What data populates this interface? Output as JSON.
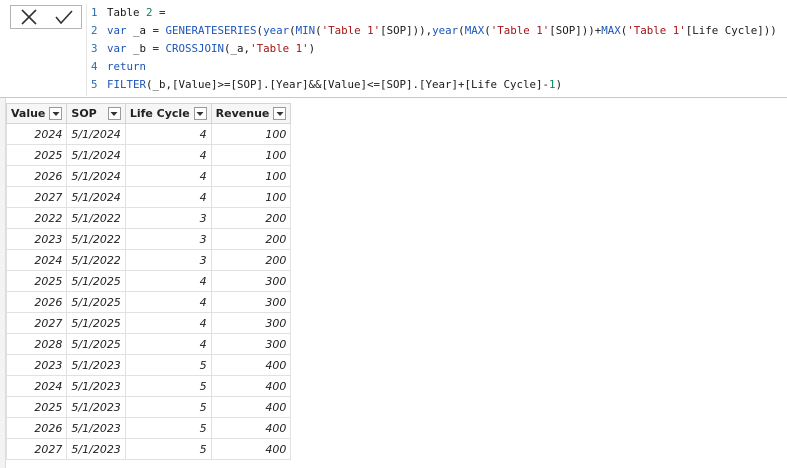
{
  "formula": {
    "lines": [
      {
        "num": "1",
        "text": "Table 2 ="
      },
      {
        "num": "2",
        "text": "var _a = GENERATESERIES(year(MIN('Table 1'[SOP])),year(MAX('Table 1'[SOP]))+MAX('Table 1'[Life Cycle]))"
      },
      {
        "num": "3",
        "text": "var _b = CROSSJOIN(_a,'Table 1')"
      },
      {
        "num": "4",
        "text": "return"
      },
      {
        "num": "5",
        "text": "FILTER(_b,[Value]>=[SOP].[Year]&&[Value]<=[SOP].[Year]+[Life Cycle]-1)"
      }
    ]
  },
  "table": {
    "columns": [
      "Value",
      "SOP",
      "Life Cycle",
      "Revenue"
    ],
    "rows": [
      [
        "2024",
        "5/1/2024",
        "4",
        "100"
      ],
      [
        "2025",
        "5/1/2024",
        "4",
        "100"
      ],
      [
        "2026",
        "5/1/2024",
        "4",
        "100"
      ],
      [
        "2027",
        "5/1/2024",
        "4",
        "100"
      ],
      [
        "2022",
        "5/1/2022",
        "3",
        "200"
      ],
      [
        "2023",
        "5/1/2022",
        "3",
        "200"
      ],
      [
        "2024",
        "5/1/2022",
        "3",
        "200"
      ],
      [
        "2025",
        "5/1/2025",
        "4",
        "300"
      ],
      [
        "2026",
        "5/1/2025",
        "4",
        "300"
      ],
      [
        "2027",
        "5/1/2025",
        "4",
        "300"
      ],
      [
        "2028",
        "5/1/2025",
        "4",
        "300"
      ],
      [
        "2023",
        "5/1/2023",
        "5",
        "400"
      ],
      [
        "2024",
        "5/1/2023",
        "5",
        "400"
      ],
      [
        "2025",
        "5/1/2023",
        "5",
        "400"
      ],
      [
        "2026",
        "5/1/2023",
        "5",
        "400"
      ],
      [
        "2027",
        "5/1/2023",
        "5",
        "400"
      ]
    ]
  },
  "colors": {
    "keyword": "#1c55b8",
    "string": "#a31515",
    "number": "#098658",
    "line_number": "#2b6cb0"
  },
  "icons": {
    "cancel": "close-icon",
    "commit": "checkmark-icon",
    "column_filter": "chevron-down-icon"
  }
}
